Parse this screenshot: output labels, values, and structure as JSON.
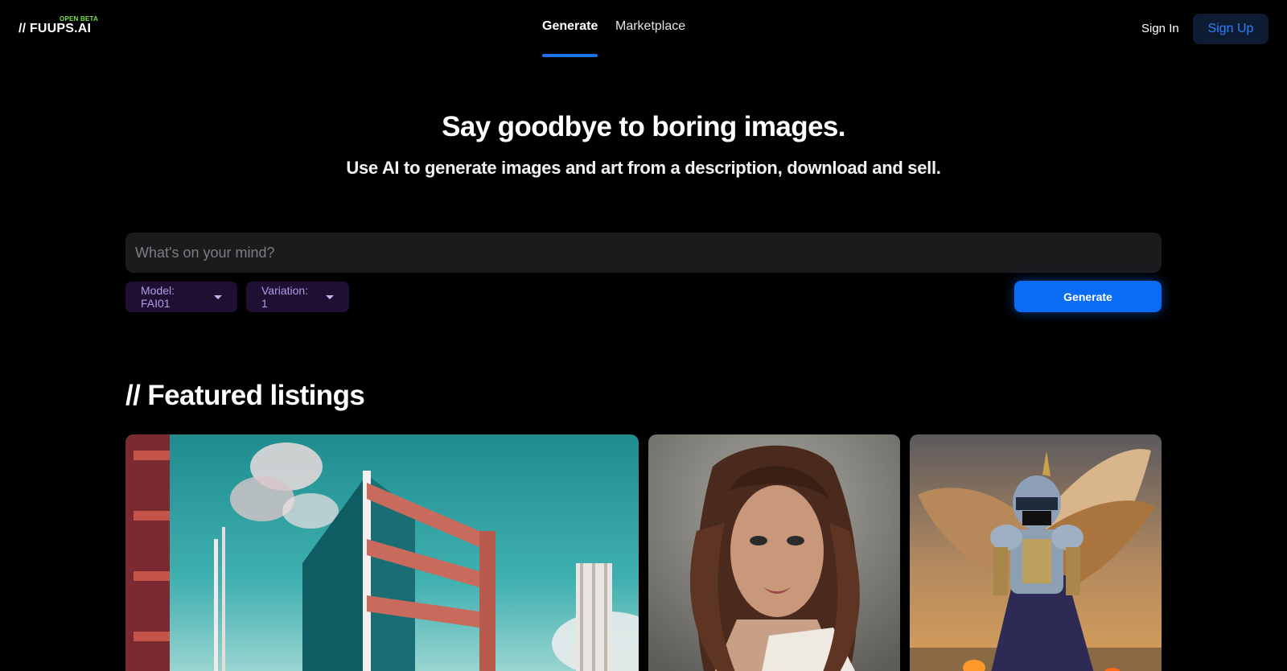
{
  "header": {
    "logo_badge": "OPEN BETA",
    "logo_text": "// FUUPS.AI",
    "nav": [
      {
        "label": "Generate",
        "active": true
      },
      {
        "label": "Marketplace",
        "active": false
      }
    ],
    "sign_in": "Sign In",
    "sign_up": "Sign Up"
  },
  "hero": {
    "title": "Say goodbye to boring images.",
    "subtitle": "Use AI to generate images and art from a description, download and sell."
  },
  "prompt": {
    "placeholder": "What's on your mind?",
    "value": "",
    "model_label": "Model: FAI01",
    "variation_label": "Variation: 1",
    "generate_label": "Generate"
  },
  "featured": {
    "title": "// Featured listings"
  },
  "colors": {
    "accent": "#1a73e8",
    "generate_button": "#0a6cf5",
    "dropdown_bg": "#1e0f33",
    "dropdown_text": "#b59be6",
    "beta_badge": "#7be04a"
  }
}
